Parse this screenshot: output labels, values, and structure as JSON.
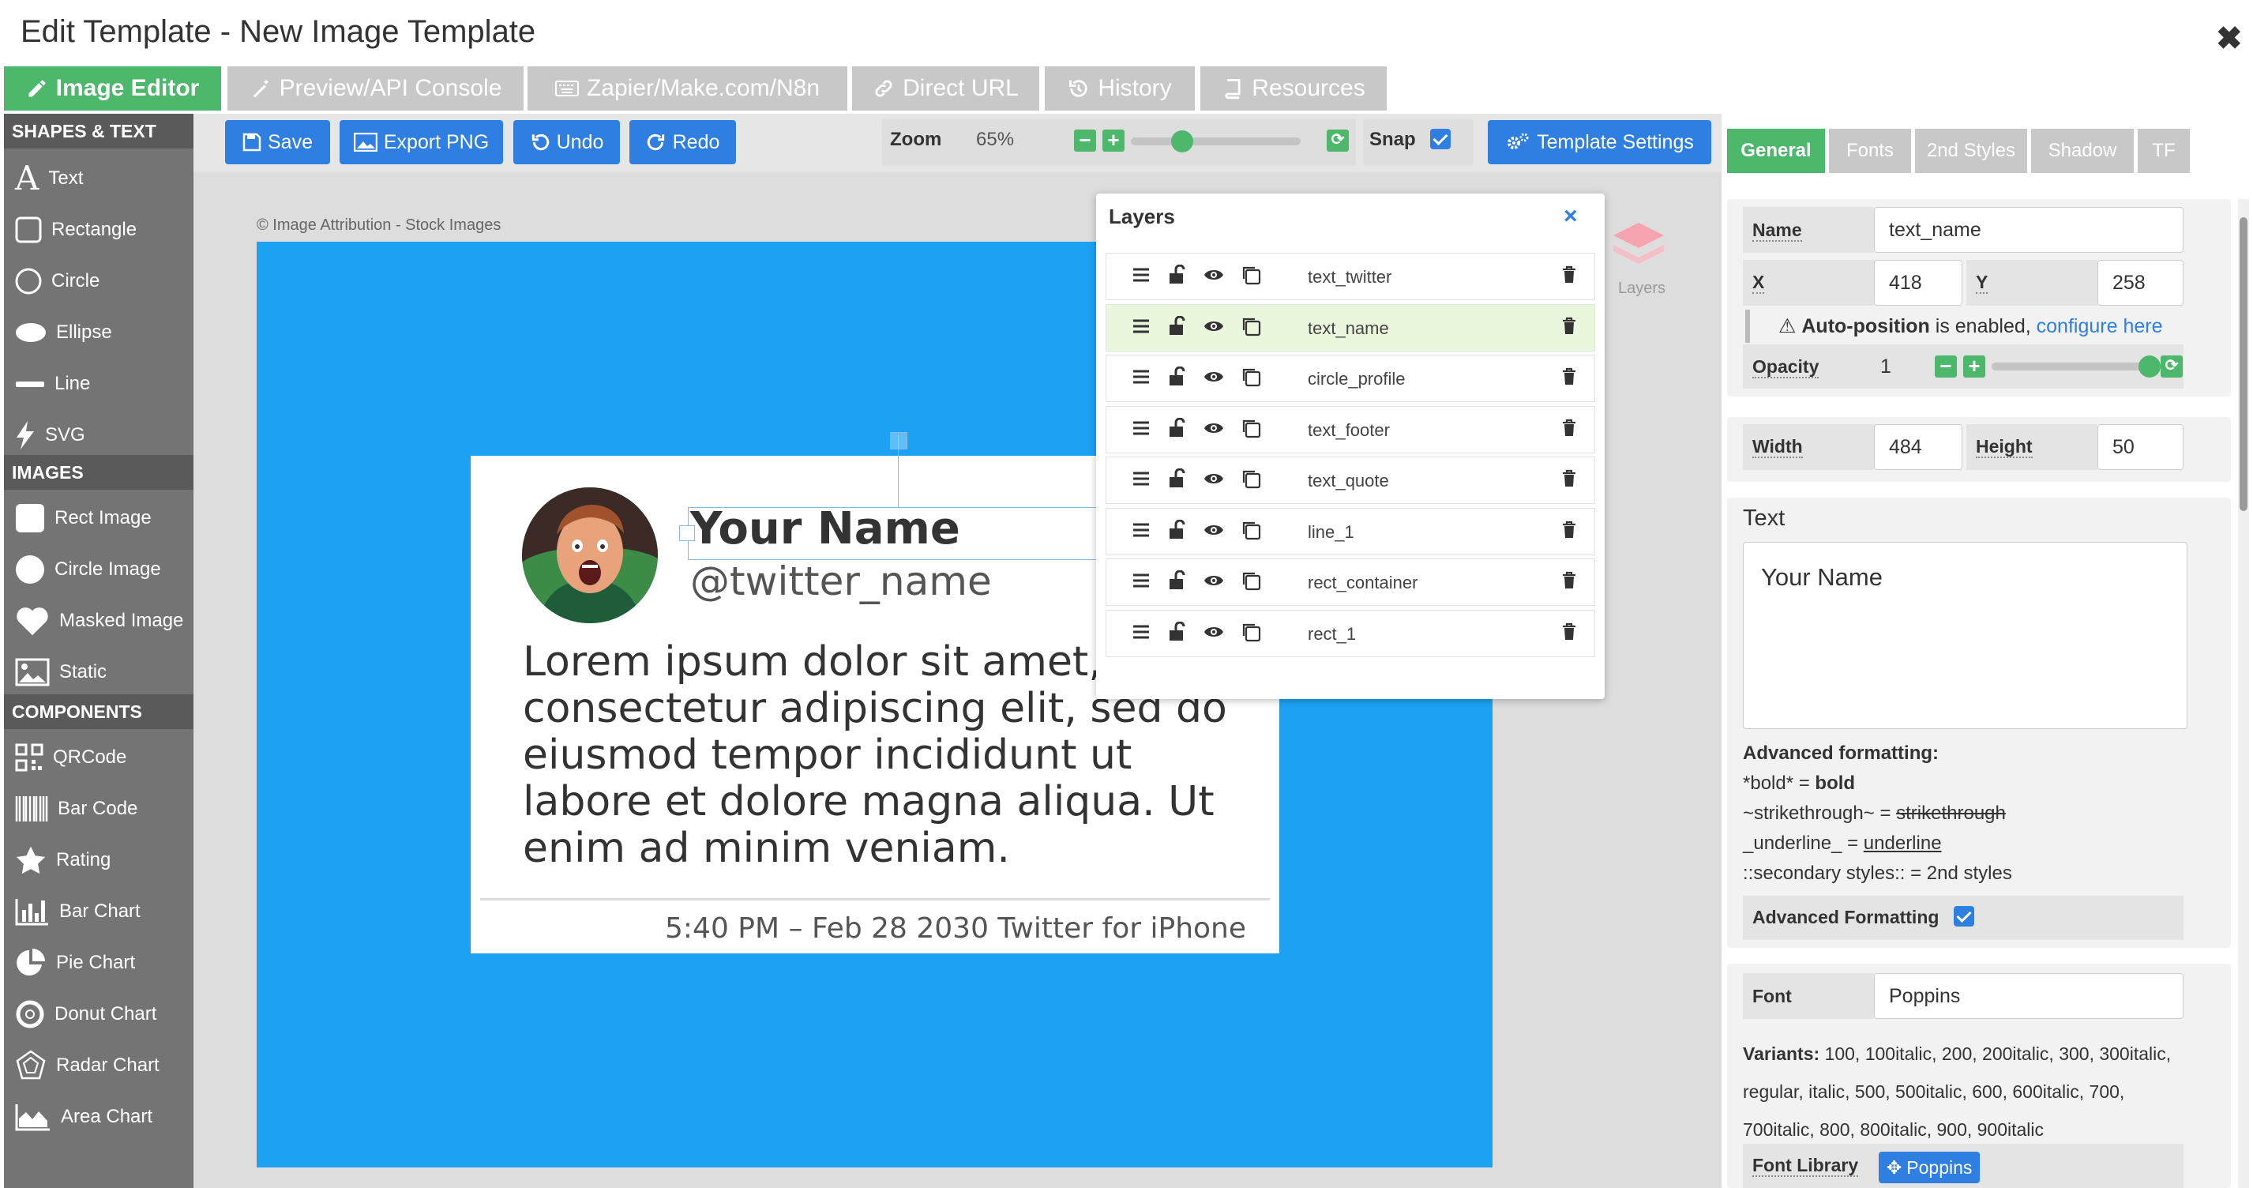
{
  "window": {
    "title": "Edit Template - New Image Template",
    "close_glyph": "✖"
  },
  "top_tabs": [
    {
      "label": "Image Editor",
      "icon": "pencil-icon"
    },
    {
      "label": "Preview/API Console",
      "icon": "wand-icon"
    },
    {
      "label": "Zapier/Make.com/N8n",
      "icon": "keyboard-icon"
    },
    {
      "label": "Direct URL",
      "icon": "link-icon"
    },
    {
      "label": "History",
      "icon": "history-icon"
    },
    {
      "label": "Resources",
      "icon": "book-icon"
    }
  ],
  "sidebar": {
    "sections": [
      {
        "title": "SHAPES & TEXT",
        "items": [
          {
            "label": "Text",
            "icon": "text-icon"
          },
          {
            "label": "Rectangle",
            "icon": "rectangle-icon"
          },
          {
            "label": "Circle",
            "icon": "circle-icon"
          },
          {
            "label": "Ellipse",
            "icon": "ellipse-icon"
          },
          {
            "label": "Line",
            "icon": "line-icon"
          },
          {
            "label": "SVG",
            "icon": "bolt-icon"
          }
        ]
      },
      {
        "title": "IMAGES",
        "items": [
          {
            "label": "Rect Image",
            "icon": "rect-image-icon"
          },
          {
            "label": "Circle Image",
            "icon": "circle-image-icon"
          },
          {
            "label": "Masked Image",
            "icon": "heart-icon"
          },
          {
            "label": "Static",
            "icon": "picture-icon"
          }
        ]
      },
      {
        "title": "COMPONENTS",
        "items": [
          {
            "label": "QRCode",
            "icon": "qrcode-icon"
          },
          {
            "label": "Bar Code",
            "icon": "barcode-icon"
          },
          {
            "label": "Rating",
            "icon": "star-icon"
          },
          {
            "label": "Bar Chart",
            "icon": "bar-chart-icon"
          },
          {
            "label": "Pie Chart",
            "icon": "pie-chart-icon"
          },
          {
            "label": "Donut Chart",
            "icon": "donut-chart-icon"
          },
          {
            "label": "Radar Chart",
            "icon": "radar-chart-icon"
          },
          {
            "label": "Area Chart",
            "icon": "area-chart-icon"
          }
        ]
      }
    ]
  },
  "toolbar": {
    "save": "Save",
    "export_png": "Export PNG",
    "undo": "Undo",
    "redo": "Redo",
    "zoom_label": "Zoom",
    "zoom_value": "65%",
    "zoom_level": 0.3,
    "snap_label": "Snap",
    "snap_checked": true,
    "template_settings": "Template Settings"
  },
  "canvas": {
    "attribution": "© Image Attribution - Stock Images",
    "background_color": "#1da1f2",
    "name": "Your Name",
    "twitter": "@twitter_name",
    "quote": "Lorem ipsum dolor sit amet, consectetur adipiscing elit, sed do eiusmod tempor incididunt ut labore et dolore magna aliqua. Ut enim ad minim veniam.",
    "footer": "5:40 PM – Feb 28 2030 Twitter for iPhone"
  },
  "layers_panel": {
    "title": "Layers",
    "floating_label": "Layers",
    "selected": "text_name",
    "rows": [
      "text_twitter",
      "text_name",
      "circle_profile",
      "text_footer",
      "text_quote",
      "line_1",
      "rect_container",
      "rect_1"
    ]
  },
  "right_panel": {
    "tabs": [
      "General",
      "Fonts",
      "2nd Styles",
      "Shadow",
      "TF"
    ],
    "name_label": "Name",
    "name_value": "text_name",
    "x_label": "X",
    "x_value": "418",
    "y_label": "Y",
    "y_value": "258",
    "autopos_bold": "Auto-position",
    "autopos_rest": " is enabled, ",
    "autopos_link": "configure here",
    "opacity_label": "Opacity",
    "opacity_value": "1",
    "opacity_level": 1.0,
    "width_label": "Width",
    "width_value": "484",
    "height_label": "Height",
    "height_value": "50",
    "text_heading": "Text",
    "text_value": "Your Name",
    "adv_title": "Advanced formatting:",
    "adv_bold_prefix": "*bold* = ",
    "adv_bold_example": "bold",
    "adv_strike_prefix": "~strikethrough~ = ",
    "adv_strike_example": "strikethrough",
    "adv_underline_prefix": "_underline_ = ",
    "adv_underline_example": "underline",
    "adv_secondary": "::secondary styles:: = 2nd styles",
    "adv_toggle_label": "Advanced Formatting",
    "adv_toggle_checked": true,
    "font_label": "Font",
    "font_value": "Poppins",
    "variants_label": "Variants:",
    "variants_line1": "100, 100italic, 200, 200italic, 300, 300italic,",
    "variants_line2": "regular, italic, 500, 500italic, 600, 600italic, 700,",
    "variants_line3": "700italic, 800, 800italic, 900, 900italic",
    "font_library_label": "Font Library",
    "font_library_value": "Poppins"
  },
  "colors": {
    "accent_green": "#4db86c",
    "button_blue": "#2f7fe2",
    "sidebar_gray": "#747474"
  }
}
